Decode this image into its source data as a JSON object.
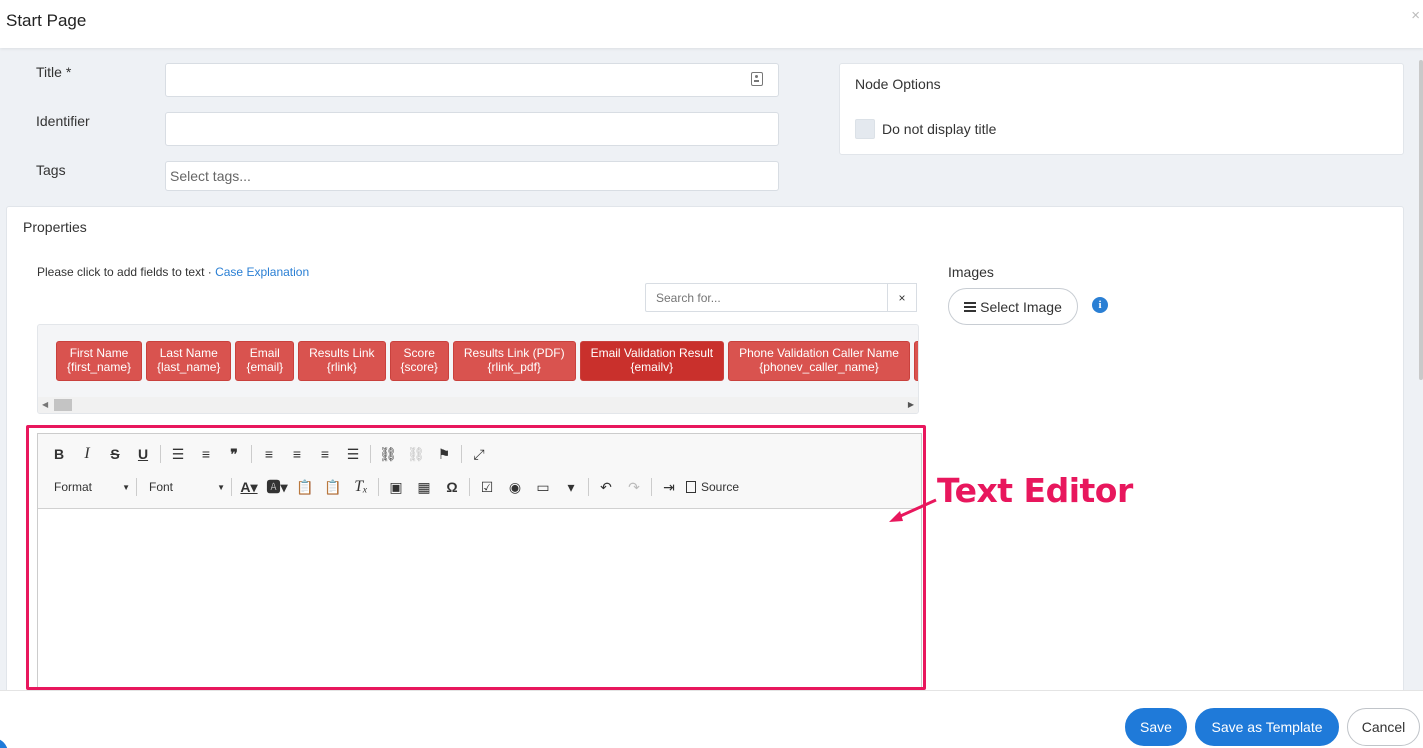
{
  "header": {
    "title": "Start Page",
    "close": "×"
  },
  "form": {
    "title_label": "Title *",
    "title_value": "",
    "identifier_label": "Identifier",
    "identifier_value": "",
    "tags_label": "Tags",
    "tags_placeholder": "Select tags..."
  },
  "node_options": {
    "title": "Node Options",
    "checkbox_label": "Do not display title",
    "checked": false
  },
  "properties": {
    "title": "Properties",
    "hint_text": "Please click to add fields to text · ",
    "hint_link": "Case Explanation",
    "search_placeholder": "Search for...",
    "search_clear": "×",
    "fields": [
      {
        "label": "First Name",
        "token": "{first_name}"
      },
      {
        "label": "Last Name",
        "token": "{last_name}"
      },
      {
        "label": "Email",
        "token": "{email}"
      },
      {
        "label": "Results Link",
        "token": "{rlink}"
      },
      {
        "label": "Score",
        "token": "{score}"
      },
      {
        "label": "Results Link (PDF)",
        "token": "{rlink_pdf}"
      },
      {
        "label": "Email Validation Result",
        "token": "{emailv}"
      },
      {
        "label": "Phone Validation Caller Name",
        "token": "{phonev_caller_name}"
      }
    ]
  },
  "editor": {
    "format_label": "Format",
    "font_label": "Font",
    "source_label": "Source"
  },
  "images": {
    "label": "Images",
    "select_button": "Select Image"
  },
  "annotation": {
    "text": "Text Editor"
  },
  "footer": {
    "save": "Save",
    "save_template": "Save as Template",
    "cancel": "Cancel"
  },
  "colors": {
    "primary": "#1f7ad9",
    "chip": "#d9534f",
    "highlight": "#e8175d"
  }
}
